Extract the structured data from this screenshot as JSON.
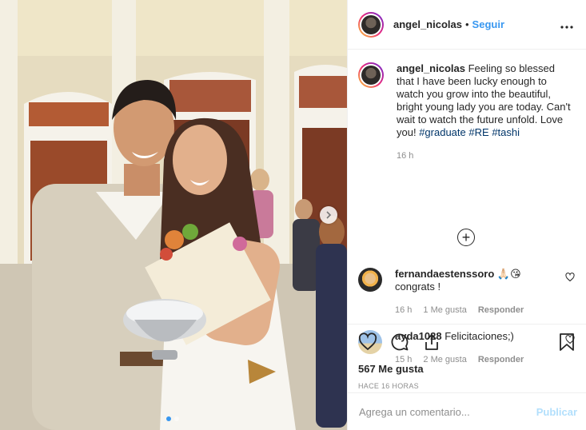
{
  "post": {
    "username": "angel_nicolas",
    "separator": "•",
    "follow_label": "Seguir",
    "more_label": "•••"
  },
  "caption": {
    "username": "angel_nicolas",
    "text": "Feeling so blessed that I have been lucky enough to watch you grow into the beautiful, bright young lady you are today. Can't wait to watch the future unfold. Love you!",
    "hashtags": [
      "#graduate",
      "#RE",
      "#tashi"
    ],
    "time": "16 h"
  },
  "comments": [
    {
      "username": "fernandaestenssoro",
      "text": "🙏🏻😘 congrats !",
      "time": "16 h",
      "likes": "1 Me gusta",
      "reply": "Responder"
    },
    {
      "username": "ayda1028",
      "text": "Felicitaciones;)",
      "time": "15 h",
      "likes": "2 Me gusta",
      "reply": "Responder"
    }
  ],
  "actions": {
    "icons": [
      "heart-icon",
      "comment-icon",
      "share-icon",
      "bookmark-icon"
    ],
    "likes": "567 Me gusta",
    "posted_ago": "HACE 16 HORAS"
  },
  "add_comment": {
    "placeholder": "Agrega un comentario...",
    "publish_label": "Publicar"
  },
  "carousel": {
    "slides": 2,
    "active": 1
  },
  "colors": {
    "link": "#3897f0",
    "hashtag": "#003569",
    "muted": "#8e8e8e",
    "publish_disabled": "#b2dffc"
  }
}
